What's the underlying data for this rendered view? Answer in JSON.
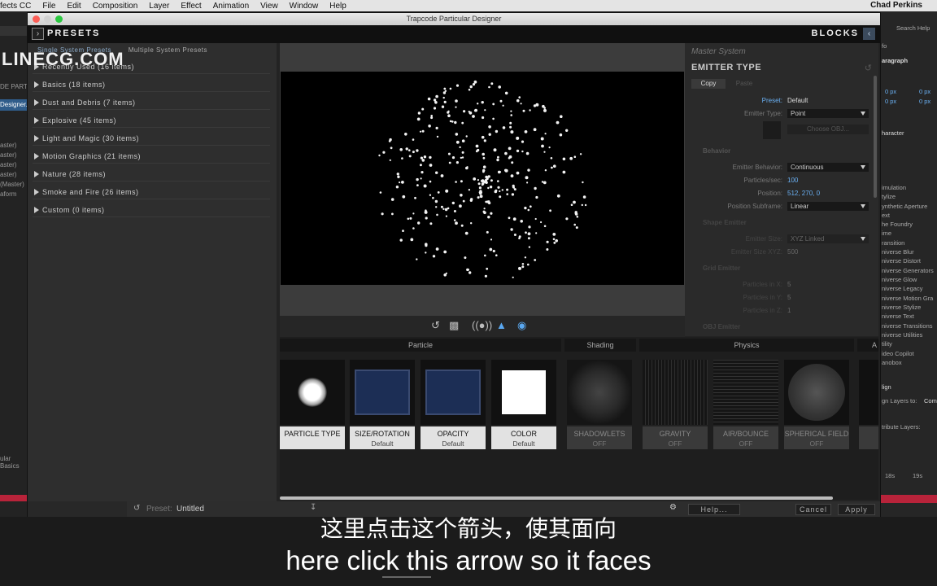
{
  "menubar": {
    "app": "fects CC",
    "items": [
      "File",
      "Edit",
      "Composition",
      "Layer",
      "Effect",
      "Animation",
      "View",
      "Window",
      "Help"
    ],
    "user": "Chad Perkins"
  },
  "behind": {
    "search_help": "Search Help",
    "left_labels": [
      "DE PART",
      "Designer...",
      "aster)",
      "aster)",
      "aster)",
      "aster)",
      "(Master)",
      "aform",
      "ular Basics"
    ],
    "right_labels": [
      "fo",
      "aragraph",
      "0 px",
      "0 px",
      "0 px",
      "0 px",
      "haracter",
      "imulation",
      "tylize",
      "ynthetic Aperture",
      "ext",
      "he Foundry",
      "ime",
      "ransition",
      "niverse Blur",
      "niverse Distort",
      "niverse Generators",
      "niverse Glow",
      "niverse Legacy",
      "niverse Motion Gra",
      "niverse Stylize",
      "niverse Text",
      "niverse Transitions",
      "niverse Utilities",
      "tility",
      "ideo Copilot",
      "anobox",
      "lign",
      "gn Layers to:",
      "Com",
      "tribute Layers:",
      "18s",
      "19s"
    ]
  },
  "window": {
    "title": "Trapcode Particular Designer",
    "presets_label": "PRESETS",
    "blocks_label": "BLOCKS"
  },
  "presets": {
    "tab_single": "Single System Presets",
    "tab_multiple": "Multiple System Presets",
    "categories": [
      "Recently Used (16 items)",
      "Basics (18 items)",
      "Dust and Debris (7 items)",
      "Explosive (45 items)",
      "Light and Magic (30 items)",
      "Motion Graphics (21 items)",
      "Nature (28 items)",
      "Smoke and Fire (26 items)",
      "Custom (0 items)"
    ]
  },
  "watermark": "LINECG.COM",
  "emitter": {
    "system": "Master System",
    "title": "EMITTER TYPE",
    "copy": "Copy",
    "paste": "Paste",
    "preset_label": "Preset:",
    "preset_value": "Default",
    "emitter_type_label": "Emitter Type:",
    "emitter_type_value": "Point",
    "choose_obj": "Choose OBJ...",
    "behavior_section": "Behavior",
    "emitter_behavior_label": "Emitter Behavior:",
    "emitter_behavior_value": "Continuous",
    "particles_label": "Particles/sec:",
    "particles_value": "100",
    "position_label": "Position:",
    "position_value": "512, 270, 0",
    "subframe_label": "Position Subframe:",
    "subframe_value": "Linear",
    "shape_section": "Shape Emitter",
    "emitter_size_label": "Emitter Size:",
    "emitter_size_value": "XYZ Linked",
    "emitter_size_xyz_label": "Emitter Size XYZ:",
    "emitter_size_xyz_value": "500",
    "grid_section": "Grid Emitter",
    "grid_x_label": "Particles in X:",
    "grid_x": "5",
    "grid_y_label": "Particles in Y:",
    "grid_y": "5",
    "grid_z_label": "Particles in Z:",
    "grid_z": "1",
    "obj_section": "OBJ Emitter"
  },
  "groups": [
    "Particle",
    "Shading",
    "Physics",
    "A"
  ],
  "blocks": [
    {
      "title": "PARTICLE TYPE",
      "sub": "",
      "off": false
    },
    {
      "title": "SIZE/ROTATION",
      "sub": "Default",
      "off": false
    },
    {
      "title": "OPACITY",
      "sub": "Default",
      "off": false
    },
    {
      "title": "COLOR",
      "sub": "Default",
      "off": false
    },
    {
      "title": "SHADOWLETS",
      "sub": "OFF",
      "off": true
    },
    {
      "title": "GRAVITY",
      "sub": "OFF",
      "off": true
    },
    {
      "title": "AIR/BOUNCE",
      "sub": "OFF",
      "off": true
    },
    {
      "title": "SPHERICAL FIELD",
      "sub": "OFF",
      "off": true
    }
  ],
  "bottom": {
    "preset_label": "Preset:",
    "preset_value": "Untitled",
    "help": "Help...",
    "cancel": "Cancel",
    "apply": "Apply"
  },
  "subtitles": {
    "zh": "这里点击这个箭头，使其面向",
    "en": "here click this arrow so it faces"
  },
  "colors": {
    "accent": "#6ab0f3",
    "blocks_arrow": "#3b4a5c"
  }
}
